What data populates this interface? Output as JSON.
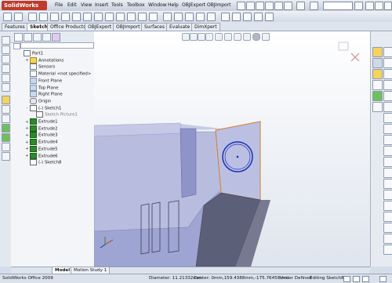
{
  "app": {
    "logo_text": "SolidWorks"
  },
  "menu": [
    "File",
    "Edit",
    "View",
    "Insert",
    "Tools",
    "Toolbox",
    "Window",
    "Help",
    "OBJExport",
    "OBJImport"
  ],
  "tabs": [
    "Features",
    "Sketch",
    "Office Products",
    "OBJExport",
    "OBJImport",
    "Surfaces",
    "Evaluate",
    "DimXpert"
  ],
  "active_tab": "Sketch",
  "tree": [
    {
      "label": "Part1",
      "icon": "part-icon",
      "indent": 0,
      "expand": ""
    },
    {
      "label": "Annotations",
      "icon": "annotations-icon",
      "indent": 1,
      "expand": "+"
    },
    {
      "label": "Sensors",
      "icon": "sensors-icon",
      "indent": 1,
      "expand": ""
    },
    {
      "label": "Material <not specified>",
      "icon": "material-icon",
      "indent": 1,
      "expand": ""
    },
    {
      "label": "Front Plane",
      "icon": "plane-icon",
      "indent": 1,
      "expand": ""
    },
    {
      "label": "Top Plane",
      "icon": "plane-icon",
      "indent": 1,
      "expand": ""
    },
    {
      "label": "Right Plane",
      "icon": "plane-icon",
      "indent": 1,
      "expand": ""
    },
    {
      "label": "Origin",
      "icon": "origin-icon",
      "indent": 1,
      "expand": ""
    },
    {
      "label": "(-) Sketch1",
      "icon": "sketch-icon",
      "indent": 1,
      "expand": "-"
    },
    {
      "label": "Sketch Picture1",
      "icon": "sketch-picture-icon",
      "indent": 2,
      "expand": ""
    },
    {
      "label": "Extrude1",
      "icon": "extrude-icon",
      "indent": 1,
      "expand": "+"
    },
    {
      "label": "Extrude2",
      "icon": "extrude-icon",
      "indent": 1,
      "expand": "+"
    },
    {
      "label": "Extrude3",
      "icon": "extrude-icon",
      "indent": 1,
      "expand": "+"
    },
    {
      "label": "Extrude4",
      "icon": "extrude-icon",
      "indent": 1,
      "expand": "+"
    },
    {
      "label": "Extrude5",
      "icon": "extrude-icon",
      "indent": 1,
      "expand": "+"
    },
    {
      "label": "Extrude6",
      "icon": "extrude-icon",
      "indent": 1,
      "expand": "+"
    },
    {
      "label": "(-) Sketch8",
      "icon": "sketch-icon",
      "indent": 1,
      "expand": ""
    }
  ],
  "bottom_tabs": [
    "Model",
    "Motion Study 1"
  ],
  "status": {
    "app_name": "SolidWorks Office 2009",
    "diameter": "Diameter: 11.21332mm",
    "center": "Center: 0mm,159.4388mm,-175.76458mm",
    "defined": "Under Defined",
    "editing": "Editing Sketch8"
  }
}
